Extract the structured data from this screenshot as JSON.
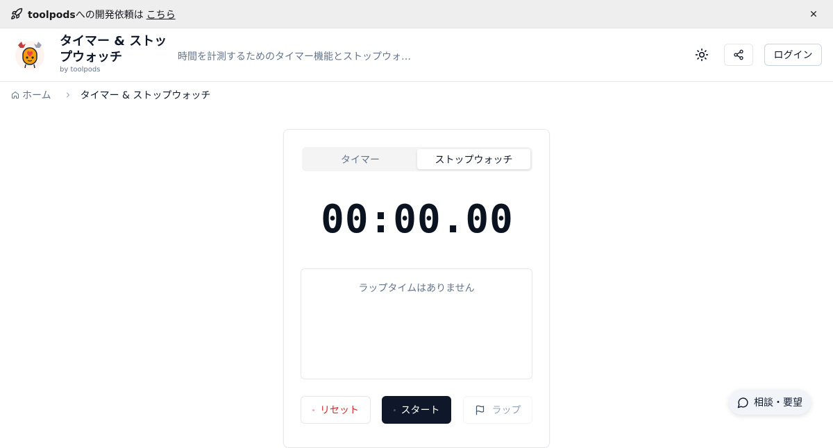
{
  "announcement": {
    "brand": "toolpods",
    "text": "への開発依頼は",
    "link": "こちら"
  },
  "header": {
    "title": "タイマー & ストップウォッチ",
    "by": "by toolpods",
    "description": "時間を計測するためのタイマー機能とストップウォ…",
    "login_label": "ログイン"
  },
  "breadcrumb": {
    "home": "ホーム",
    "current": "タイマー & ストップウォッチ"
  },
  "tabs": [
    {
      "label": "タイマー",
      "active": false
    },
    {
      "label": "ストップウォッチ",
      "active": true
    }
  ],
  "stopwatch": {
    "time": "00:00.00",
    "laps_empty": "ラップタイムはありません",
    "reset_label": "リセット",
    "start_label": "スタート",
    "lap_label": "ラップ"
  },
  "consult": {
    "label": "相談・要望"
  },
  "colors": {
    "primary": "#0f172a",
    "danger": "#dc2626",
    "muted": "#64748b",
    "border": "#e5e7eb"
  },
  "icons": [
    "rocket-icon",
    "close-icon",
    "sun-icon",
    "share-icon",
    "home-icon",
    "chevron-right-icon",
    "flag-icon",
    "chat-icon"
  ]
}
